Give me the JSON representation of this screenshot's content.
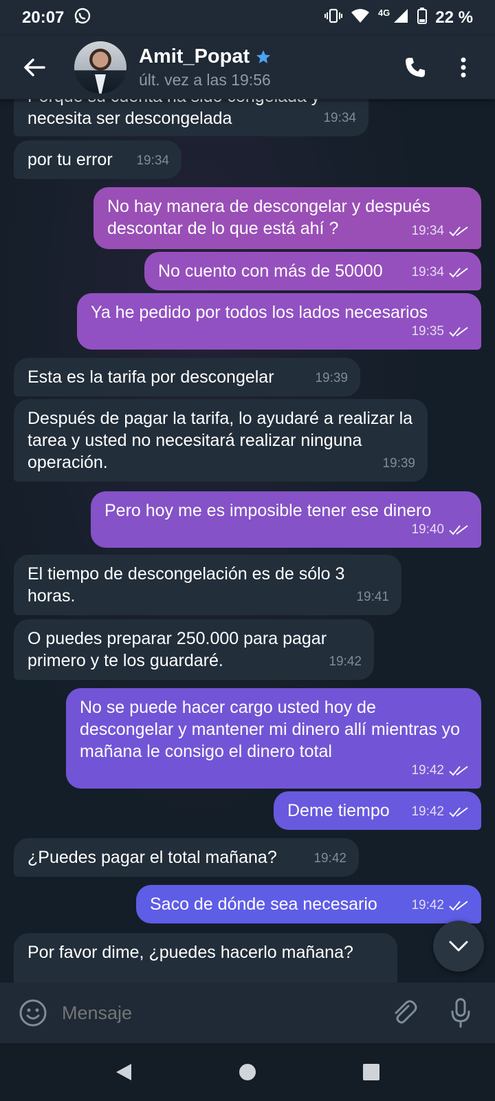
{
  "status_bar": {
    "time": "20:07",
    "network": "4G",
    "battery": "22 %"
  },
  "header": {
    "contact_name": "Amit_Popat",
    "last_seen": "últ. vez a las 19:56"
  },
  "colors": {
    "header_bg": "#1f2a36",
    "incoming_bubble": "#222e3a",
    "outgoing_top": "#9b4fb8",
    "outgoing_bottom": "#5b63e8",
    "accent_star": "#4ba3f0"
  },
  "messages": [
    {
      "dir": "in",
      "text": "Porque su cuenta ha sido congelada y necesita ser descongelada",
      "time": "19:34"
    },
    {
      "dir": "in",
      "text": "por tu error",
      "time": "19:34"
    },
    {
      "dir": "out",
      "text": "No hay manera de descongelar y después descontar de lo que está ahí ?",
      "time": "19:34"
    },
    {
      "dir": "out",
      "text": "No cuento con más de 50000",
      "time": "19:34"
    },
    {
      "dir": "out",
      "text": "Ya he pedido por todos los lados necesarios",
      "time": "19:35"
    },
    {
      "dir": "in",
      "text": "Esta es la tarifa por descongelar",
      "time": "19:39"
    },
    {
      "dir": "in",
      "text": "Después de pagar la tarifa, lo ayudaré a realizar la tarea y usted no necesitará realizar ninguna operación.",
      "time": "19:39"
    },
    {
      "dir": "out",
      "text": "Pero hoy me es imposible tener ese dinero",
      "time": "19:40"
    },
    {
      "dir": "in",
      "text": "El tiempo de descongelación es de sólo 3 horas.",
      "time": "19:41"
    },
    {
      "dir": "in",
      "text": "O puedes preparar 250.000 para pagar primero y te los guardaré.",
      "time": "19:42"
    },
    {
      "dir": "out",
      "text": "No se puede hacer cargo usted hoy de descongelar y mantener mi dinero allí mientras yo mañana le consigo el dinero total",
      "time": "19:42"
    },
    {
      "dir": "out",
      "text": "Deme tiempo",
      "time": "19:42"
    },
    {
      "dir": "in",
      "text": "¿Puedes pagar el total mañana?",
      "time": "19:42"
    },
    {
      "dir": "out",
      "text": "Saco de dónde sea necesario",
      "time": "19:42"
    },
    {
      "dir": "in",
      "text": "Por favor dime, ¿puedes hacerlo mañana?",
      "time": ""
    }
  ],
  "composer": {
    "placeholder": "Mensaje"
  }
}
